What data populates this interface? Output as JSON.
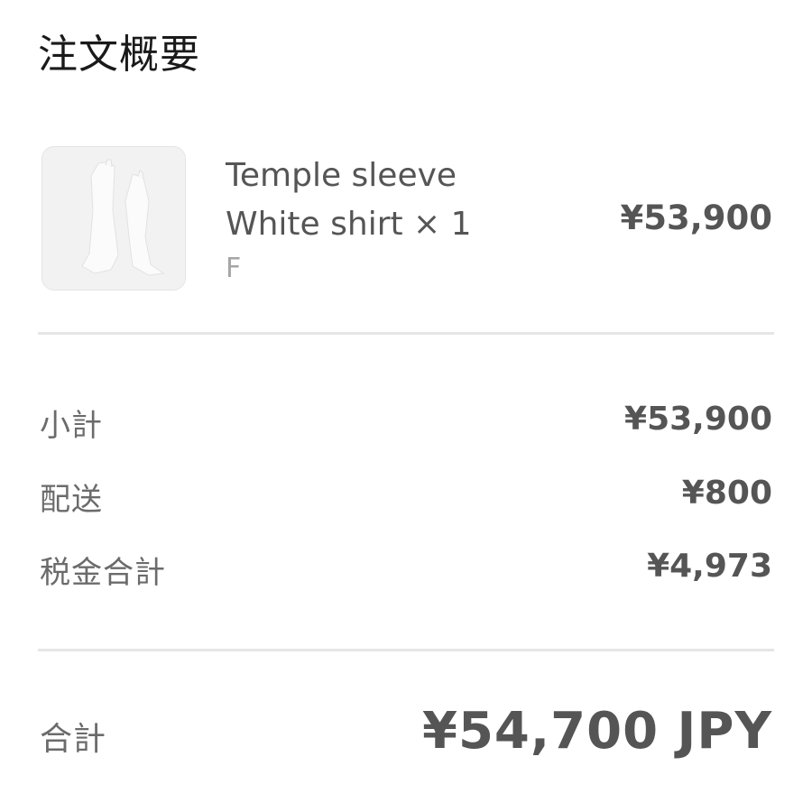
{
  "order_summary": {
    "title": "注文概要",
    "item": {
      "image_alt": "white shirt",
      "name_line1": "Temple sleeve",
      "name_line2": "White shirt × 1",
      "variant": "F",
      "price": "¥53,900"
    },
    "rows": [
      {
        "label": "小計",
        "value": "¥53,900"
      },
      {
        "label": "配送",
        "value": "¥800"
      },
      {
        "label": "税金合計",
        "value": "¥4,973"
      }
    ],
    "total": {
      "label": "合計",
      "value": "¥54,700 JPY"
    }
  }
}
